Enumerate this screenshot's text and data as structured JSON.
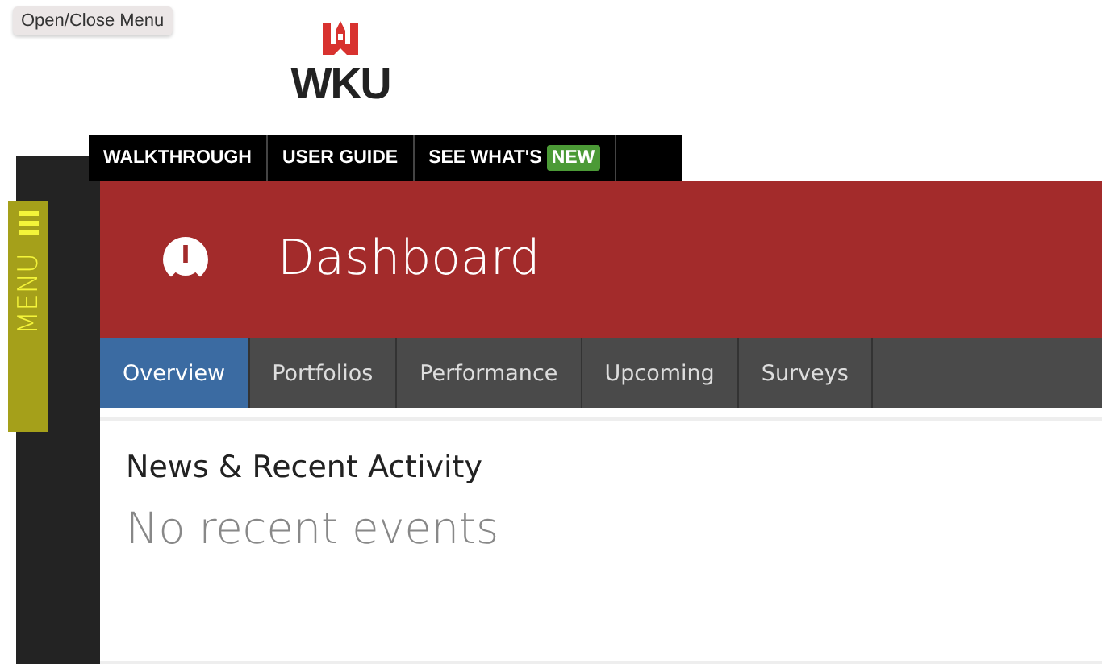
{
  "tooltip": "Open/Close Menu",
  "logo": {
    "text": "WKU"
  },
  "top_links": [
    {
      "label": "WALKTHROUGH"
    },
    {
      "label": "USER GUIDE"
    },
    {
      "label": "SEE WHAT'S",
      "badge": "NEW"
    }
  ],
  "menu_toggle": {
    "label": "MENU"
  },
  "header": {
    "title": "Dashboard"
  },
  "tabs": [
    {
      "label": "Overview",
      "selected": true
    },
    {
      "label": "Portfolios",
      "selected": false
    },
    {
      "label": "Performance",
      "selected": false
    },
    {
      "label": "Upcoming",
      "selected": false
    },
    {
      "label": "Surveys",
      "selected": false
    }
  ],
  "news": {
    "heading": "News & Recent Activity",
    "empty_message": "No recent events"
  }
}
